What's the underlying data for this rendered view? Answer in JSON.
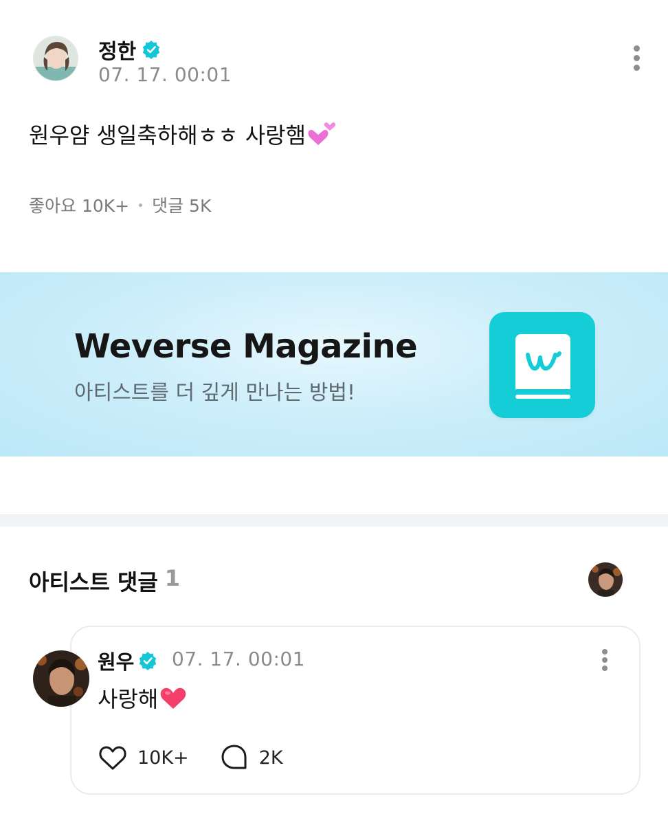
{
  "post": {
    "author": "정한",
    "time": "07. 17. 00:01",
    "text": "원우얌 생일축하해ㅎㅎ 사랑햄",
    "likes_label": "좋아요 10K+",
    "comments_label": "댓글 5K"
  },
  "banner": {
    "title": "Weverse Magazine",
    "subtitle": "아티스트를 더 깊게 만나는 방법!",
    "logo_color": "#14cdd6"
  },
  "artist_comments": {
    "title": "아티스트 댓글",
    "count": "1",
    "comment": {
      "author": "원우",
      "time": "07. 17. 00:01",
      "text": "사랑해",
      "likes": "10K+",
      "replies": "2K"
    }
  },
  "colors": {
    "verified": "#14c6d6",
    "banner_bg": "#cdeefa",
    "muted_text": "#8a8a8a"
  }
}
